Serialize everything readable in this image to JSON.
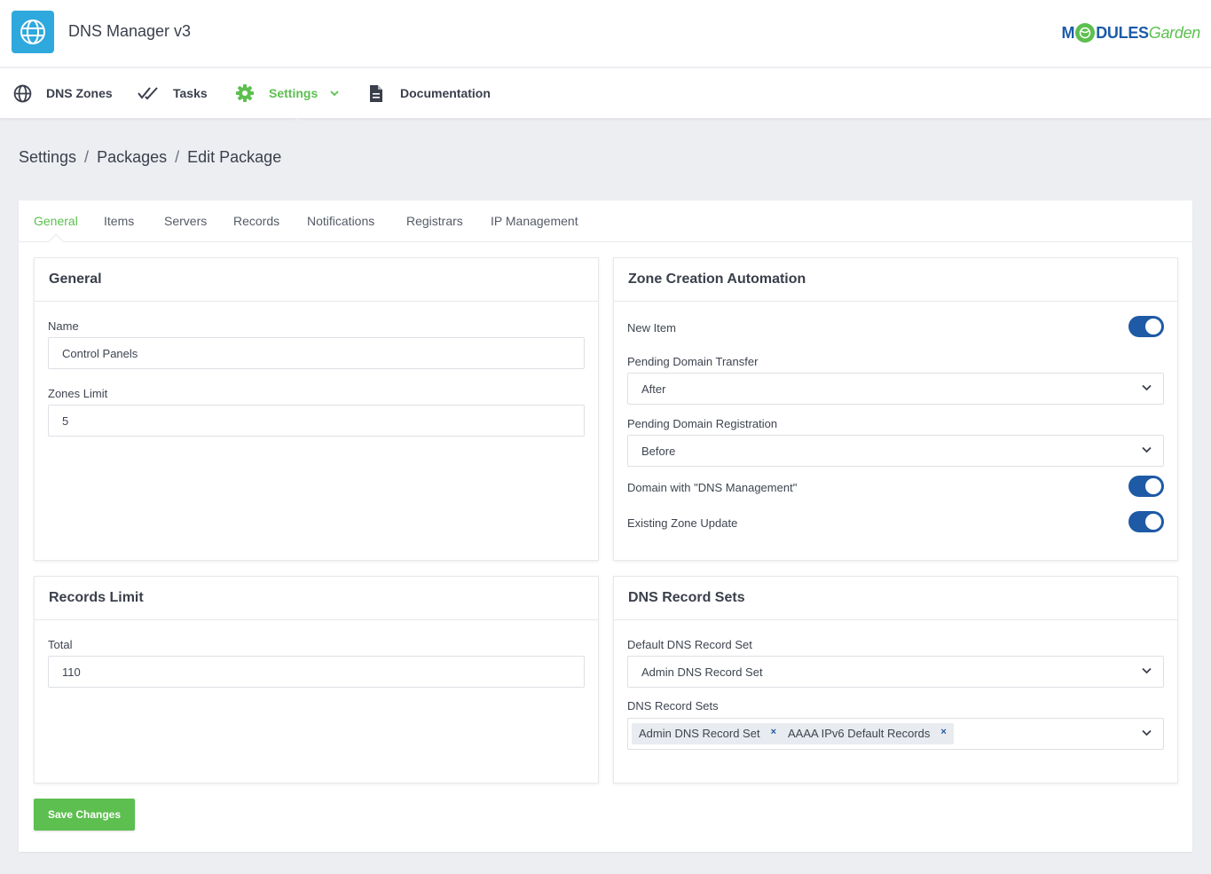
{
  "app": {
    "title": "DNS Manager v3",
    "icon": "globe-icon"
  },
  "brand": {
    "part1": "M",
    "part2": "DULES",
    "part3": "Garden",
    "colors": {
      "blue": "#1c5ca8",
      "green": "#5cbf4f"
    }
  },
  "nav": {
    "items": [
      {
        "label": "DNS Zones",
        "icon": "globe-icon"
      },
      {
        "label": "Tasks",
        "icon": "double-check-icon"
      },
      {
        "label": "Settings",
        "icon": "gear-icon",
        "active": true
      },
      {
        "label": "Documentation",
        "icon": "document-icon"
      }
    ]
  },
  "breadcrumb": [
    "Settings",
    "Packages",
    "Edit Package"
  ],
  "breadcrumb_sep": "/",
  "tabs": [
    "General",
    "Items",
    "Servers",
    "Records",
    "Notifications",
    "Registrars",
    "IP Management"
  ],
  "active_tab": "General",
  "general": {
    "title": "General",
    "name_label": "Name",
    "name_value": "Control Panels",
    "zones_label": "Zones Limit",
    "zones_value": "5"
  },
  "zone": {
    "title": "Zone Creation Automation",
    "new_item_label": "New Item",
    "new_item_on": true,
    "transfer_label": "Pending Domain Transfer",
    "transfer_value": "After",
    "registration_label": "Pending Domain Registration",
    "registration_value": "Before",
    "dns_mgmt_label": "Domain with \"DNS Management\"",
    "dns_mgmt_on": true,
    "existing_label": "Existing Zone Update",
    "existing_on": true
  },
  "records": {
    "title": "Records Limit",
    "total_label": "Total",
    "total_value": "110"
  },
  "dns_sets": {
    "title": "DNS Record Sets",
    "default_label": "Default DNS Record Set",
    "default_value": "Admin DNS Record Set",
    "sets_label": "DNS Record Sets",
    "chips": [
      "Admin DNS Record Set",
      "AAAA IPv6 Default Records"
    ],
    "remove_symbol": "×"
  },
  "save_label": "Save Changes",
  "colors": {
    "accent": "#5cbf4f",
    "toggle": "#1e5aa5",
    "app_icon": "#2ea8dd"
  }
}
